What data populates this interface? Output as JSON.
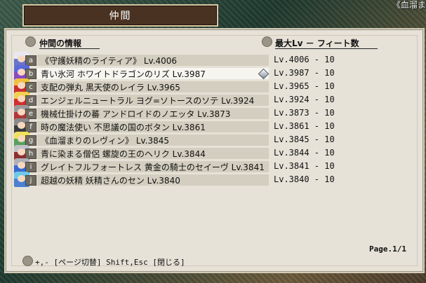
{
  "background": {
    "caption": "《血溜ま"
  },
  "window": {
    "title": "仲間"
  },
  "headers": {
    "info": "仲間の情報",
    "stats": "最大Lv － フィート数"
  },
  "party": [
    {
      "key": "a",
      "name": "《守護妖精のライティア》 Lv.4006",
      "stats": "Lv.4006 - 10",
      "hair": "#e8e8f0",
      "outfit": "#6a74c8"
    },
    {
      "key": "b",
      "name": "青い氷河 ホワイトドラゴンのリズ Lv.3987",
      "stats": "Lv.3987 - 10",
      "hair": "#5a6ad8",
      "outfit": "#8a4ac0"
    },
    {
      "key": "c",
      "name": "支配の弾丸 黒天使のレイラ Lv.3965",
      "stats": "Lv.3965 - 10",
      "hair": "#f0c040",
      "outfit": "#c83030"
    },
    {
      "key": "d",
      "name": "エンジェルニュートラル ヨグ=ソトースのソテ Lv.3924",
      "stats": "Lv.3924 - 10",
      "hair": "#f0d050",
      "outfit": "#d03030"
    },
    {
      "key": "e",
      "name": "機械仕掛けの蕃 アンドロイドのノエッタ Lv.3873",
      "stats": "Lv.3873 - 10",
      "hair": "#9a9a9a",
      "outfit": "#b03838"
    },
    {
      "key": "f",
      "name": "時の魔法使い 不思議の国のボタン Lv.3861",
      "stats": "Lv.3861 - 10",
      "hair": "#8a8a8a",
      "outfit": "#3a3a3a"
    },
    {
      "key": "g",
      "name": "《血溜まりのレヴィン》 Lv.3845",
      "stats": "Lv.3845 - 10",
      "hair": "#f0e060",
      "outfit": "#5aa060"
    },
    {
      "key": "h",
      "name": "青に染まる僧侶 螺旋の王のヘリク Lv.3844",
      "stats": "Lv.3844 - 10",
      "hair": "#c0c0c8",
      "outfit": "#8a3030"
    },
    {
      "key": "i",
      "name": "グレイトフルフォートレス 黄金の騎士のセイーヴ Lv.3841",
      "stats": "Lv.3841 - 10",
      "hair": "#b0b0b8",
      "outfit": "#3a6ad0"
    },
    {
      "key": "j",
      "name": "超越の妖精 妖精さんのセン Lv.3840",
      "stats": "Lv.3840 - 10",
      "hair": "#70c8e8",
      "outfit": "#4a80d0"
    }
  ],
  "selected_index": 1,
  "page": "Page.1/1",
  "help": "+,- [ページ切替]  Shift,Esc [閉じる]",
  "colors": {
    "panel_bg": "#e6e2d8",
    "title_bg": "#4a3222",
    "key_bg": "#6f6a60"
  }
}
